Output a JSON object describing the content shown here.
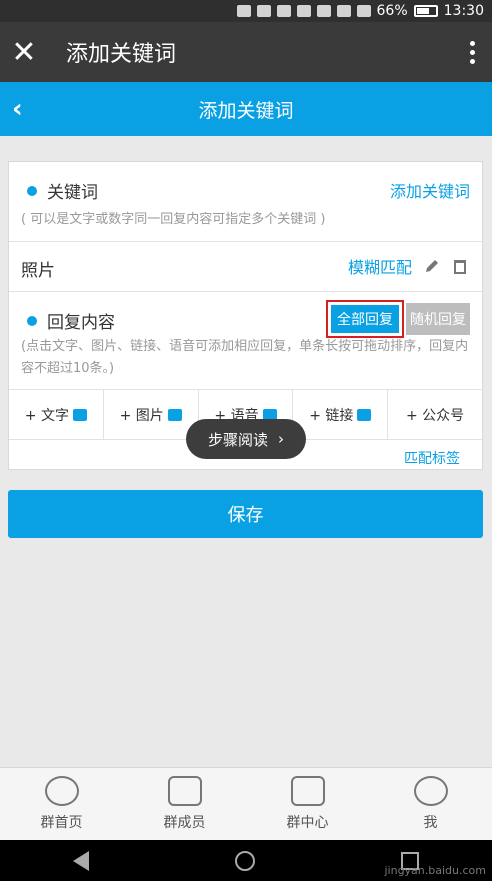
{
  "status": {
    "battery": "66%",
    "time": "13:30"
  },
  "titlebar": {
    "title": "添加关键词"
  },
  "nav": {
    "title": "添加关键词"
  },
  "keyword": {
    "label": "关键词",
    "add_link": "添加关键词",
    "hint": "( 可以是文字或数字同一回复内容可指定多个关键词 )"
  },
  "photo": {
    "label": "照片",
    "match": "模糊匹配"
  },
  "reply": {
    "label": "回复内容",
    "all_btn": "全部回复",
    "random_btn": "随机回复",
    "hint": "(点击文字、图片、链接、语音可添加相应回复，单条长按可拖动排序，回复内容不超过10条。)"
  },
  "actions": [
    "+ 文字",
    "+ 图片",
    "+ 语音",
    "+ 链接",
    "+ 公众号"
  ],
  "match_tag": "匹配标签",
  "tooltip": "步骤阅读",
  "save": "保存",
  "tabs": [
    "群首页",
    "群成员",
    "群中心",
    "我"
  ],
  "watermark": "jingyan.baidu.com"
}
